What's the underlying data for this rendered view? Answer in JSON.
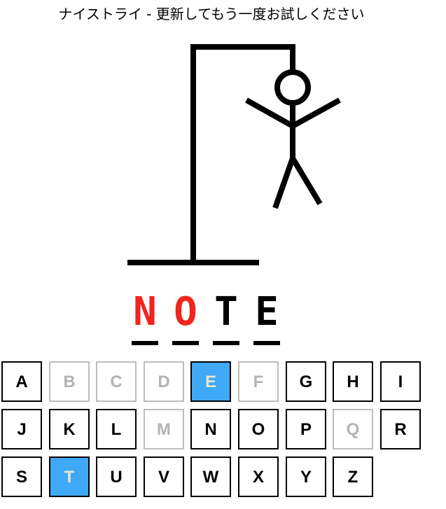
{
  "message": "ナイストライ - 更新してもう一度お試しください",
  "colors": {
    "revealed_letter": "#f0251d",
    "guessed_letter": "#000000",
    "correct_key_bg": "#3fa9f5",
    "correct_key_text": "#e9e4d3",
    "disabled_key": "#b3b3b3",
    "drawing": "#000000"
  },
  "word": [
    {
      "char": "N",
      "state": "revealed"
    },
    {
      "char": "O",
      "state": "revealed"
    },
    {
      "char": "T",
      "state": "guessed"
    },
    {
      "char": "E",
      "state": "guessed"
    }
  ],
  "keyboard": [
    {
      "label": "A",
      "state": "available"
    },
    {
      "label": "B",
      "state": "disabled"
    },
    {
      "label": "C",
      "state": "disabled"
    },
    {
      "label": "D",
      "state": "disabled"
    },
    {
      "label": "E",
      "state": "correct"
    },
    {
      "label": "F",
      "state": "disabled"
    },
    {
      "label": "G",
      "state": "available"
    },
    {
      "label": "H",
      "state": "available"
    },
    {
      "label": "I",
      "state": "available"
    },
    {
      "label": "J",
      "state": "available"
    },
    {
      "label": "K",
      "state": "available"
    },
    {
      "label": "L",
      "state": "available"
    },
    {
      "label": "M",
      "state": "disabled"
    },
    {
      "label": "N",
      "state": "available"
    },
    {
      "label": "O",
      "state": "available"
    },
    {
      "label": "P",
      "state": "available"
    },
    {
      "label": "Q",
      "state": "disabled"
    },
    {
      "label": "R",
      "state": "available"
    },
    {
      "label": "S",
      "state": "available"
    },
    {
      "label": "T",
      "state": "correct"
    },
    {
      "label": "U",
      "state": "available"
    },
    {
      "label": "V",
      "state": "available"
    },
    {
      "label": "W",
      "state": "available"
    },
    {
      "label": "X",
      "state": "available"
    },
    {
      "label": "Y",
      "state": "available"
    },
    {
      "label": "Z",
      "state": "available"
    }
  ]
}
